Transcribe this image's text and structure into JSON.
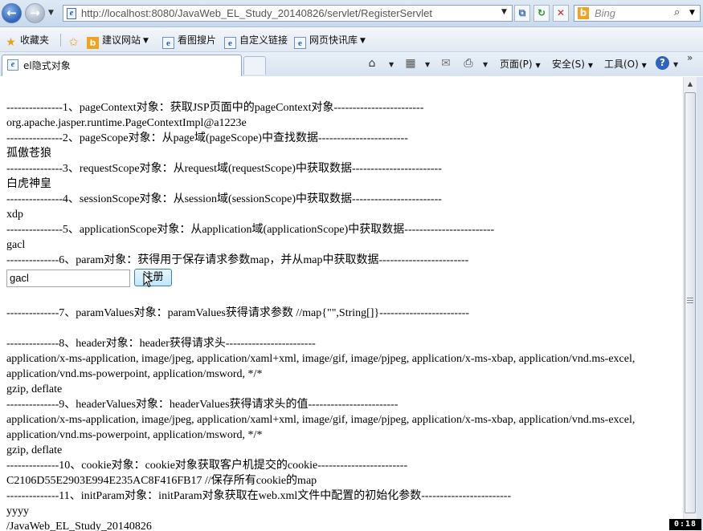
{
  "browser": {
    "url": "http://localhost:8080/JavaWeb_EL_Study_20140826/servlet/RegisterServlet",
    "search_placeholder": "Bing",
    "favorites_bar": {
      "favorites_label": "收藏夹",
      "items": [
        "建议网站",
        "看图搜片",
        "自定义链接",
        "网页快讯库"
      ]
    },
    "tab_title": "el隐式对象",
    "commands": {
      "page": "页面(P)",
      "safety": "安全(S)",
      "tools": "工具(O)"
    }
  },
  "content": {
    "lines": {
      "l1": "---------------1、pageContext对象：获取JSP页面中的pageContext对象------------------------",
      "v1": "org.apache.jasper.runtime.PageContextImpl@a1223e",
      "l2": "---------------2、pageScope对象：从page域(pageScope)中查找数据------------------------",
      "v2": "孤傲苍狼",
      "l3": "---------------3、requestScope对象：从request域(requestScope)中获取数据------------------------",
      "v3": "白虎神皇",
      "l4": "---------------4、sessionScope对象：从session域(sessionScope)中获取数据------------------------",
      "v4": "xdp",
      "l5": "---------------5、applicationScope对象：从application域(applicationScope)中获取数据------------------------",
      "v5": "gacl",
      "l6": "--------------6、param对象：获得用于保存请求参数map，并从map中获取数据------------------------",
      "l7": "--------------7、paramValues对象：paramValues获得请求参数 //map{\"\",String[]}------------------------",
      "l8": "--------------8、header对象：header获得请求头------------------------",
      "v8a": "application/x-ms-application, image/jpeg, application/xaml+xml, image/gif, image/pjpeg, application/x-ms-xbap, application/vnd.ms-excel, application/vnd.ms-powerpoint, application/msword, */*",
      "v8b": "gzip, deflate",
      "l9": "--------------9、headerValues对象：headerValues获得请求头的值------------------------",
      "v9a": "application/x-ms-application, image/jpeg, application/xaml+xml, image/gif, image/pjpeg, application/x-ms-xbap, application/vnd.ms-excel, application/vnd.ms-powerpoint, application/msword, */*",
      "v9b": "gzip, deflate",
      "l10": "--------------10、cookie对象：cookie对象获取客户机提交的cookie------------------------",
      "v10": "C2106D55E2903E994E235AC8F416FB17 //保存所有cookie的map",
      "l11": "--------------11、initParam对象：initParam对象获取在web.xml文件中配置的初始化参数------------------------",
      "v11a": "yyyy",
      "v11b": "/JavaWeb_EL_Study_20140826"
    },
    "form": {
      "input_value": "gacl",
      "submit_label": "注册"
    }
  },
  "overlay": {
    "timer": "0:18"
  }
}
